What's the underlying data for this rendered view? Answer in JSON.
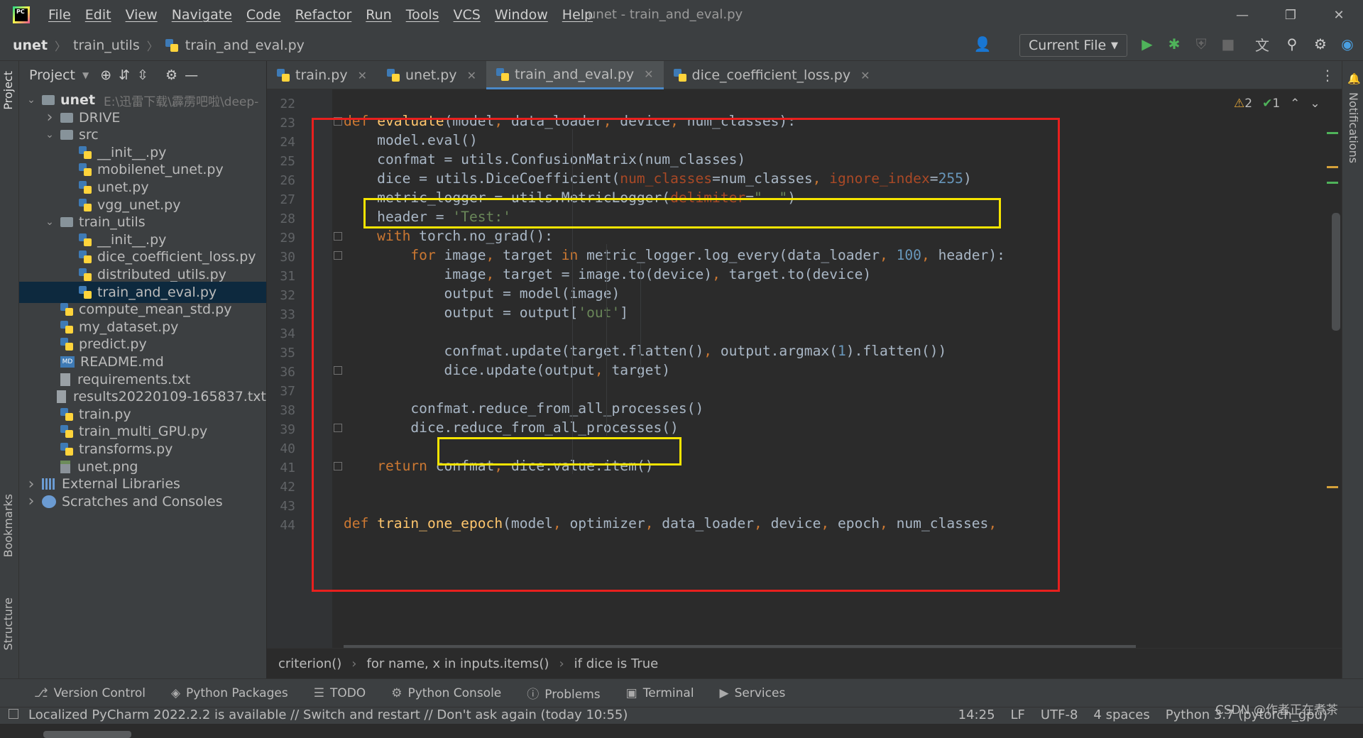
{
  "app": {
    "window_title": "unet - train_and_eval.py",
    "menus": [
      "File",
      "Edit",
      "View",
      "Navigate",
      "Code",
      "Refactor",
      "Run",
      "Tools",
      "VCS",
      "Window",
      "Help"
    ],
    "logo_text": "PC"
  },
  "breadcrumb": [
    "unet",
    "train_utils",
    "train_and_eval.py"
  ],
  "toolbar": {
    "run_config": "Current File"
  },
  "left_stripe": {
    "project": "Project",
    "bookmarks": "Bookmarks",
    "structure": "Structure"
  },
  "right_stripe": {
    "notifications": "Notifications"
  },
  "project_panel": {
    "title": "Project",
    "tree": [
      {
        "label": "unet",
        "path": "E:\\迅雷下载\\霹雳吧啦\\deep-",
        "type": "folder",
        "depth": 0,
        "expanded": true
      },
      {
        "label": "DRIVE",
        "type": "folder",
        "depth": 1,
        "expanded": false
      },
      {
        "label": "src",
        "type": "folder",
        "depth": 1,
        "expanded": true
      },
      {
        "label": "__init__.py",
        "type": "py",
        "depth": 2
      },
      {
        "label": "mobilenet_unet.py",
        "type": "py",
        "depth": 2
      },
      {
        "label": "unet.py",
        "type": "py",
        "depth": 2
      },
      {
        "label": "vgg_unet.py",
        "type": "py",
        "depth": 2
      },
      {
        "label": "train_utils",
        "type": "folder",
        "depth": 1,
        "expanded": true
      },
      {
        "label": "__init__.py",
        "type": "py",
        "depth": 2
      },
      {
        "label": "dice_coefficient_loss.py",
        "type": "py",
        "depth": 2
      },
      {
        "label": "distributed_utils.py",
        "type": "py",
        "depth": 2
      },
      {
        "label": "train_and_eval.py",
        "type": "py",
        "depth": 2,
        "selected": true
      },
      {
        "label": "compute_mean_std.py",
        "type": "py",
        "depth": 1
      },
      {
        "label": "my_dataset.py",
        "type": "py",
        "depth": 1
      },
      {
        "label": "predict.py",
        "type": "py",
        "depth": 1
      },
      {
        "label": "README.md",
        "type": "md",
        "depth": 1
      },
      {
        "label": "requirements.txt",
        "type": "txt",
        "depth": 1
      },
      {
        "label": "results20220109-165837.txt",
        "type": "txt",
        "depth": 1
      },
      {
        "label": "train.py",
        "type": "py",
        "depth": 1
      },
      {
        "label": "train_multi_GPU.py",
        "type": "py",
        "depth": 1
      },
      {
        "label": "transforms.py",
        "type": "py",
        "depth": 1
      },
      {
        "label": "unet.png",
        "type": "png",
        "depth": 1
      },
      {
        "label": "External Libraries",
        "type": "lib",
        "depth": 0,
        "expanded": false
      },
      {
        "label": "Scratches and Consoles",
        "type": "scratch",
        "depth": 0,
        "expanded": false
      }
    ]
  },
  "tabs": [
    {
      "label": "train.py",
      "active": false
    },
    {
      "label": "unet.py",
      "active": false
    },
    {
      "label": "train_and_eval.py",
      "active": true
    },
    {
      "label": "dice_coefficient_loss.py",
      "active": false
    }
  ],
  "inspections": {
    "warnings": "2",
    "ok": "1"
  },
  "code": {
    "first_line": 21,
    "lines": [
      [],
      [],
      [
        [
          "kw",
          "def "
        ],
        [
          "fn",
          "evaluate"
        ],
        [
          "",
          "(model"
        ],
        [
          "kw",
          ", "
        ],
        [
          "",
          "data_loader"
        ],
        [
          "kw",
          ", "
        ],
        [
          "",
          "device"
        ],
        [
          "kw",
          ", "
        ],
        [
          "",
          "num_classes):"
        ]
      ],
      [
        [
          "",
          "    model.eval()"
        ]
      ],
      [
        [
          "",
          "    confmat = utils.ConfusionMatrix(num_classes)"
        ]
      ],
      [
        [
          "",
          "    dice = utils.DiceCoefficient("
        ],
        [
          "par",
          "num_classes"
        ],
        [
          "",
          "=num_classes"
        ],
        [
          "kw",
          ", "
        ],
        [
          "par",
          "ignore_index"
        ],
        [
          "",
          "="
        ],
        [
          "num",
          "255"
        ],
        [
          "",
          ")"
        ]
      ],
      [
        [
          "",
          "    metric_logger = utils.MetricLogger("
        ],
        [
          "par",
          "delimiter"
        ],
        [
          "",
          "="
        ],
        [
          "str",
          "\"  \""
        ],
        [
          "",
          ")"
        ]
      ],
      [
        [
          "",
          "    header = "
        ],
        [
          "str",
          "'Test:'"
        ]
      ],
      [
        [
          "kw",
          "    with "
        ],
        [
          "",
          "torch.no_grad():"
        ]
      ],
      [
        [
          "kw",
          "        for "
        ],
        [
          "",
          "image"
        ],
        [
          "kw",
          ", "
        ],
        [
          "",
          "target "
        ],
        [
          "kw",
          "in "
        ],
        [
          "",
          "metric_logger.log_every(data_loader"
        ],
        [
          "kw",
          ", "
        ],
        [
          "num",
          "100"
        ],
        [
          "kw",
          ", "
        ],
        [
          "",
          "header):"
        ]
      ],
      [
        [
          "",
          "            image"
        ],
        [
          "kw",
          ", "
        ],
        [
          "",
          "target = image.to(device)"
        ],
        [
          "kw",
          ", "
        ],
        [
          "",
          "target.to(device)"
        ]
      ],
      [
        [
          "",
          "            output = model(image)"
        ]
      ],
      [
        [
          "",
          "            output = output["
        ],
        [
          "str",
          "'out'"
        ],
        [
          "",
          "]"
        ]
      ],
      [],
      [
        [
          "",
          "            confmat.update(target.flatten()"
        ],
        [
          "kw",
          ", "
        ],
        [
          "",
          "output.argmax("
        ],
        [
          "num",
          "1"
        ],
        [
          "",
          ").flatten())"
        ]
      ],
      [
        [
          "",
          "            dice.update(output"
        ],
        [
          "kw",
          ", "
        ],
        [
          "",
          "target)"
        ]
      ],
      [],
      [
        [
          "",
          "        confmat.reduce_from_all_processes()"
        ]
      ],
      [
        [
          "",
          "        dice.reduce_from_all_processes()"
        ]
      ],
      [],
      [
        [
          "kw",
          "    return "
        ],
        [
          "",
          "confmat"
        ],
        [
          "kw",
          ", "
        ],
        [
          "",
          "dice.value.item()"
        ]
      ],
      [],
      [],
      [
        [
          "kw",
          "def "
        ],
        [
          "fn",
          "train_one_epoch"
        ],
        [
          "",
          "(model"
        ],
        [
          "kw",
          ", "
        ],
        [
          "",
          "optimizer"
        ],
        [
          "kw",
          ", "
        ],
        [
          "",
          "data_loader"
        ],
        [
          "kw",
          ", "
        ],
        [
          "",
          "device"
        ],
        [
          "kw",
          ", "
        ],
        [
          "",
          "epoch"
        ],
        [
          "kw",
          ", "
        ],
        [
          "",
          "num_classes"
        ],
        [
          "kw",
          ","
        ]
      ]
    ]
  },
  "code_breadcrumb": [
    "criterion()",
    "for name, x in inputs.items()",
    "if dice is True"
  ],
  "tool_windows": [
    "Version Control",
    "Python Packages",
    "TODO",
    "Python Console",
    "Problems",
    "Terminal",
    "Services"
  ],
  "status": {
    "message": "Localized PyCharm 2022.2.2 is available // Switch and restart // Don't ask again (today 10:55)",
    "position": "14:25",
    "line_sep": "LF",
    "encoding": "UTF-8",
    "indent": "4 spaces",
    "interpreter": "Python 3.7 (pytorch_gpu)"
  },
  "watermark": "CSDN @作者正在煮茶",
  "colors": {
    "highlight_red": "#e8201e",
    "highlight_yellow": "#f5e400",
    "selection": "#0d293e"
  }
}
